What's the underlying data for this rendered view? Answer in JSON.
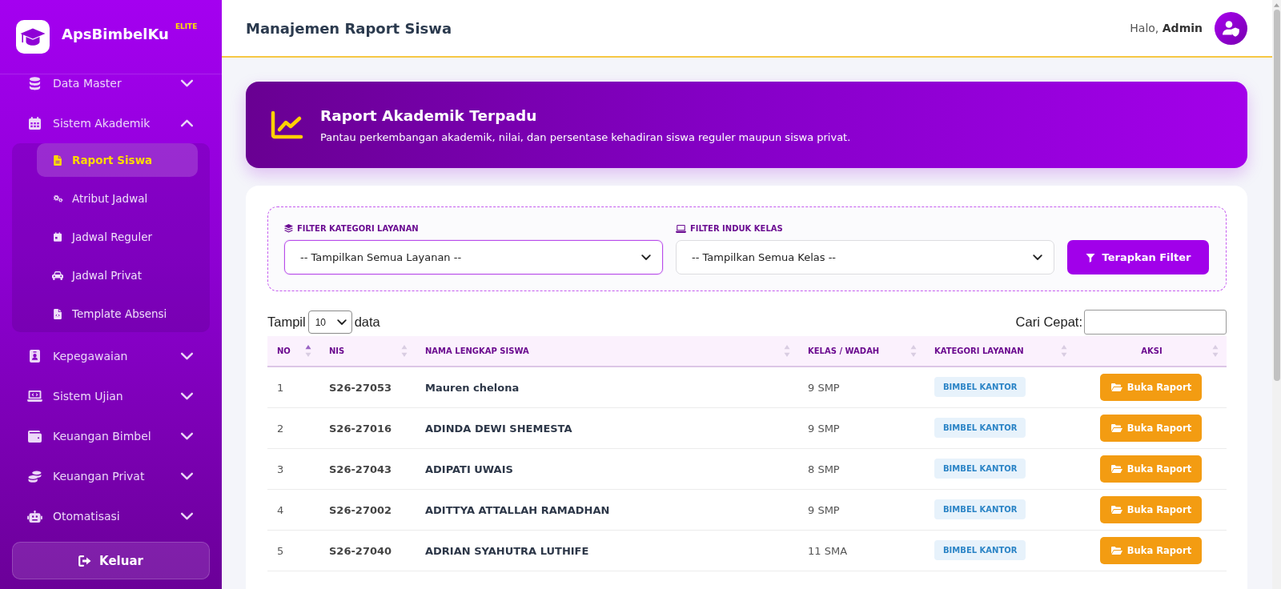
{
  "sidebar": {
    "brand": "ApsBimbelKu",
    "brand_badge": "ELITE",
    "menu": [
      {
        "label": "Data Master",
        "expanded": false
      },
      {
        "label": "Sistem Akademik",
        "expanded": true,
        "children": [
          {
            "label": "Raport Siswa",
            "selected": true
          },
          {
            "label": "Atribut Jadwal",
            "selected": false
          },
          {
            "label": "Jadwal Reguler",
            "selected": false
          },
          {
            "label": "Jadwal Privat",
            "selected": false
          },
          {
            "label": "Template Absensi",
            "selected": false
          }
        ]
      },
      {
        "label": "Kepegawaian",
        "expanded": false
      },
      {
        "label": "Sistem Ujian",
        "expanded": false
      },
      {
        "label": "Keuangan Bimbel",
        "expanded": false
      },
      {
        "label": "Keuangan Privat",
        "expanded": false
      },
      {
        "label": "Otomatisasi",
        "expanded": false
      }
    ],
    "logout": "Keluar"
  },
  "header": {
    "title": "Manajemen Raport Siswa",
    "greeting": "Halo, **Admin**"
  },
  "banner": {
    "title": "Raport Akademik Terpadu",
    "subtitle": "Pantau perkembangan akademik, nilai, dan persentase kehadiran siswa reguler maupun siswa privat."
  },
  "filters": {
    "fields": [
      {
        "label": "FILTER KATEGORI LAYANAN",
        "value": "-- Tampilkan Semua Layanan --",
        "focused": true
      },
      {
        "label": "FILTER INDUK KELAS",
        "value": "-- Tampilkan Semua Kelas --",
        "focused": false
      }
    ],
    "button": "Terapkan Filter"
  },
  "table_controls": {
    "length_label": "Tampil",
    "length_value": "10",
    "length_suffix": "data",
    "search_label": "Cari Cepat:"
  },
  "table": {
    "columns": [
      {
        "label": "NO",
        "sorted": true
      },
      {
        "label": "NIS",
        "sorted": false
      },
      {
        "label": "NAMA LENGKAP SISWA",
        "sorted": false
      },
      {
        "label": "KELAS / WADAH",
        "sorted": false
      },
      {
        "label": "KATEGORI LAYANAN",
        "sorted": false
      },
      {
        "label": "AKSI",
        "sorted": false
      }
    ],
    "rows": [
      {
        "no": "1",
        "nis": "S26-27053",
        "name": "Mauren chelona",
        "kelas": "9 SMP",
        "kategori": "BIMBEL KANTOR",
        "action": "Buka Raport"
      },
      {
        "no": "2",
        "nis": "S26-27016",
        "name": "ADINDA DEWI SHEMESTA",
        "kelas": "9 SMP",
        "kategori": "BIMBEL KANTOR",
        "action": "Buka Raport"
      },
      {
        "no": "3",
        "nis": "S26-27043",
        "name": "ADIPATI UWAIS",
        "kelas": "8 SMP",
        "kategori": "BIMBEL KANTOR",
        "action": "Buka Raport"
      },
      {
        "no": "4",
        "nis": "S26-27002",
        "name": "ADITTYA ATTALLAH RAMADHAN",
        "kelas": "9 SMP",
        "kategori": "BIMBEL KANTOR",
        "action": "Buka Raport"
      },
      {
        "no": "5",
        "nis": "S26-27040",
        "name": "ADRIAN SYAHUTRA LUTHIFE",
        "kelas": "11 SMA",
        "kategori": "BIMBEL KANTOR",
        "action": "Buka Raport"
      }
    ]
  }
}
